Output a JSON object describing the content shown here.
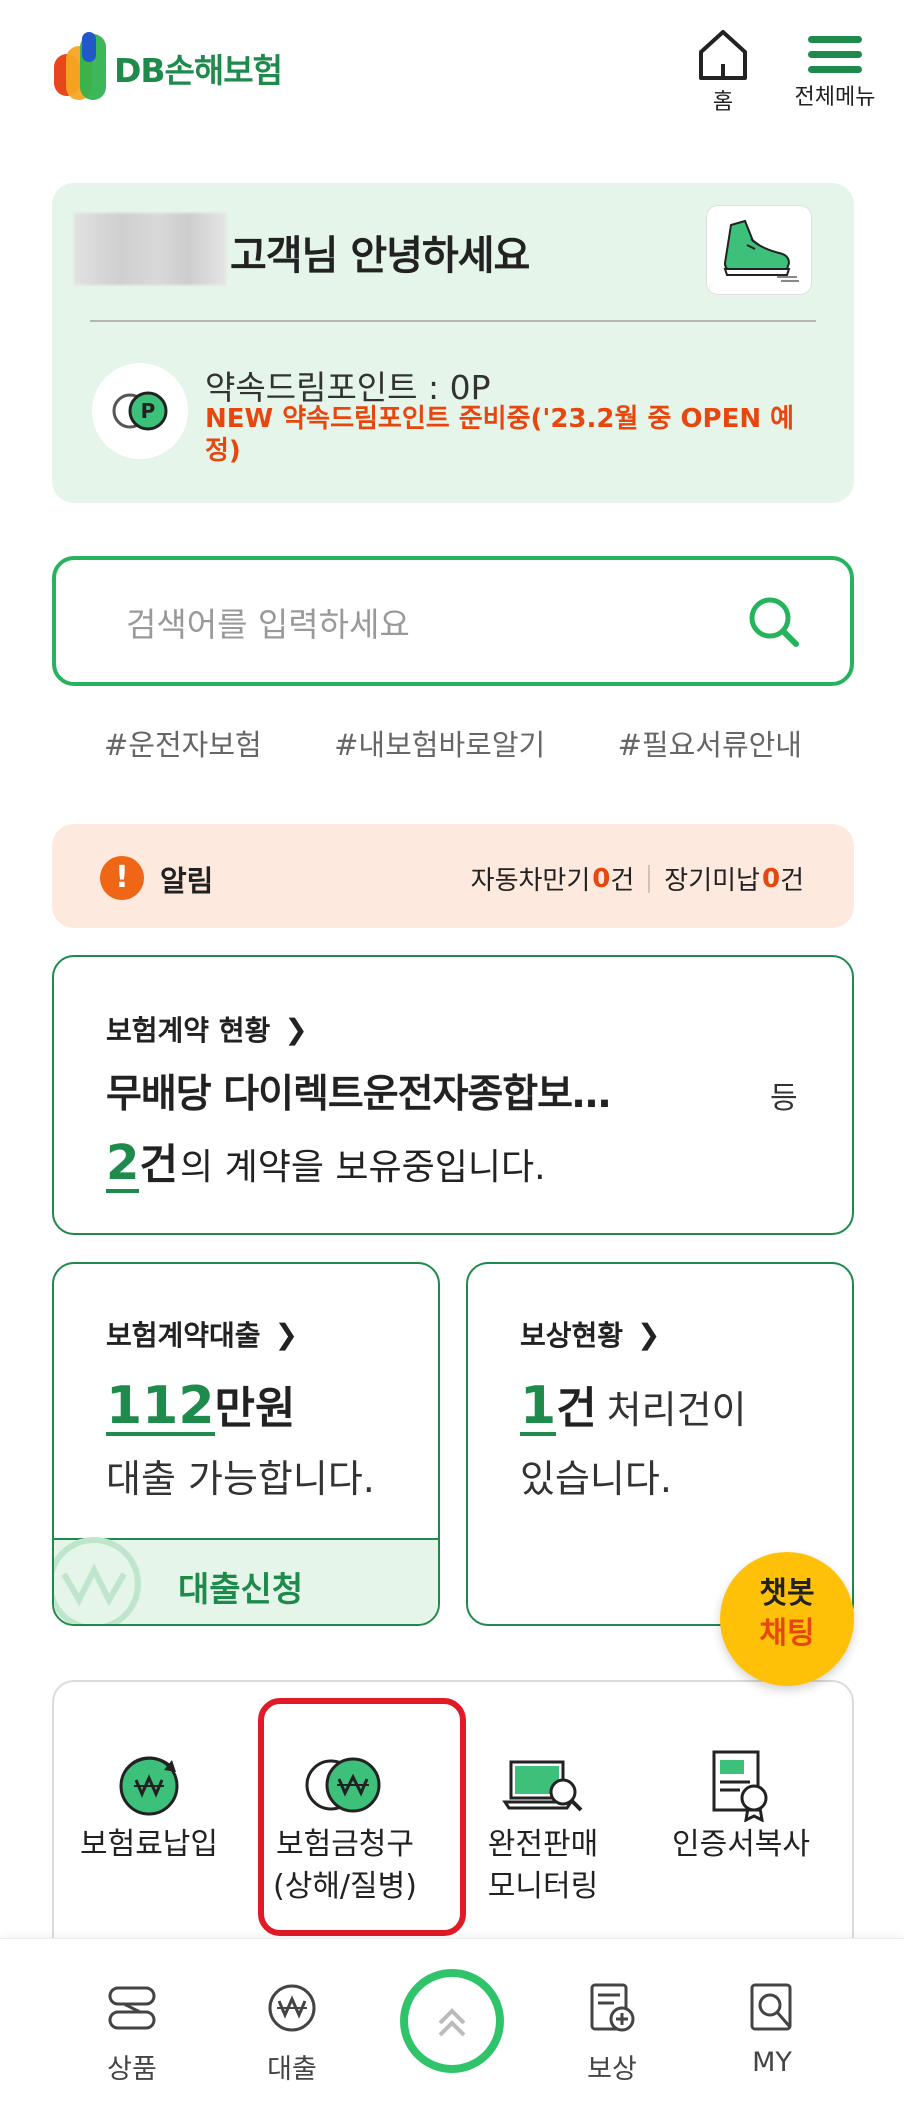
{
  "header": {
    "logo_text": "DB손해보험",
    "home_label": "홈",
    "menu_label": "전체메뉴"
  },
  "greeting": {
    "text": "고객님 안녕하세요",
    "points_label": "약속드림포인트  :  0P",
    "points_notice": "NEW 약속드림포인트 준비중('23.2월 중 OPEN 예정)"
  },
  "search": {
    "placeholder": "검색어를 입력하세요",
    "hashtags": [
      "#운전자보험",
      "#내보험바로알기",
      "#필요서류안내"
    ]
  },
  "alert": {
    "title": "알림",
    "auto_label": "자동차만기",
    "auto_count": "0",
    "long_label": "장기미납",
    "long_count": "0",
    "unit": "건"
  },
  "contract": {
    "title": "보험계약 현황",
    "product_name": "무배당 다이렉트운전자종합보…",
    "suffix": "등",
    "count": "2",
    "count_unit": "건",
    "count_text": "의 계약을 보유중입니다."
  },
  "loan": {
    "title": "보험계약대출",
    "amount": "112",
    "amount_unit": "만원",
    "desc": "대출 가능합니다.",
    "apply_label": "대출신청"
  },
  "claims": {
    "title": "보상현황",
    "count": "1",
    "count_unit": "건",
    "count_text": "처리건이",
    "desc": "있습니다."
  },
  "chatbot": {
    "line1": "챗봇",
    "line2": "채팅"
  },
  "quick_menu": [
    {
      "line1": "보험료납입",
      "line2": "",
      "icon": "premium-payment-icon"
    },
    {
      "line1": "보험금청구",
      "line2": "(상해/질병)",
      "icon": "claim-request-icon"
    },
    {
      "line1": "완전판매",
      "line2": "모니터링",
      "icon": "sales-monitoring-icon"
    },
    {
      "line1": "인증서복사",
      "line2": "",
      "icon": "certificate-copy-icon"
    }
  ],
  "bottom_nav": {
    "products": "상품",
    "loan": "대출",
    "compensation": "보상",
    "my": "MY"
  },
  "colors": {
    "brand_green": "#1e8a4c",
    "accent_green": "#27b35e",
    "alert_orange": "#e8460f",
    "highlight_red": "#e01a26",
    "chatbot_yellow": "#ffc107"
  }
}
